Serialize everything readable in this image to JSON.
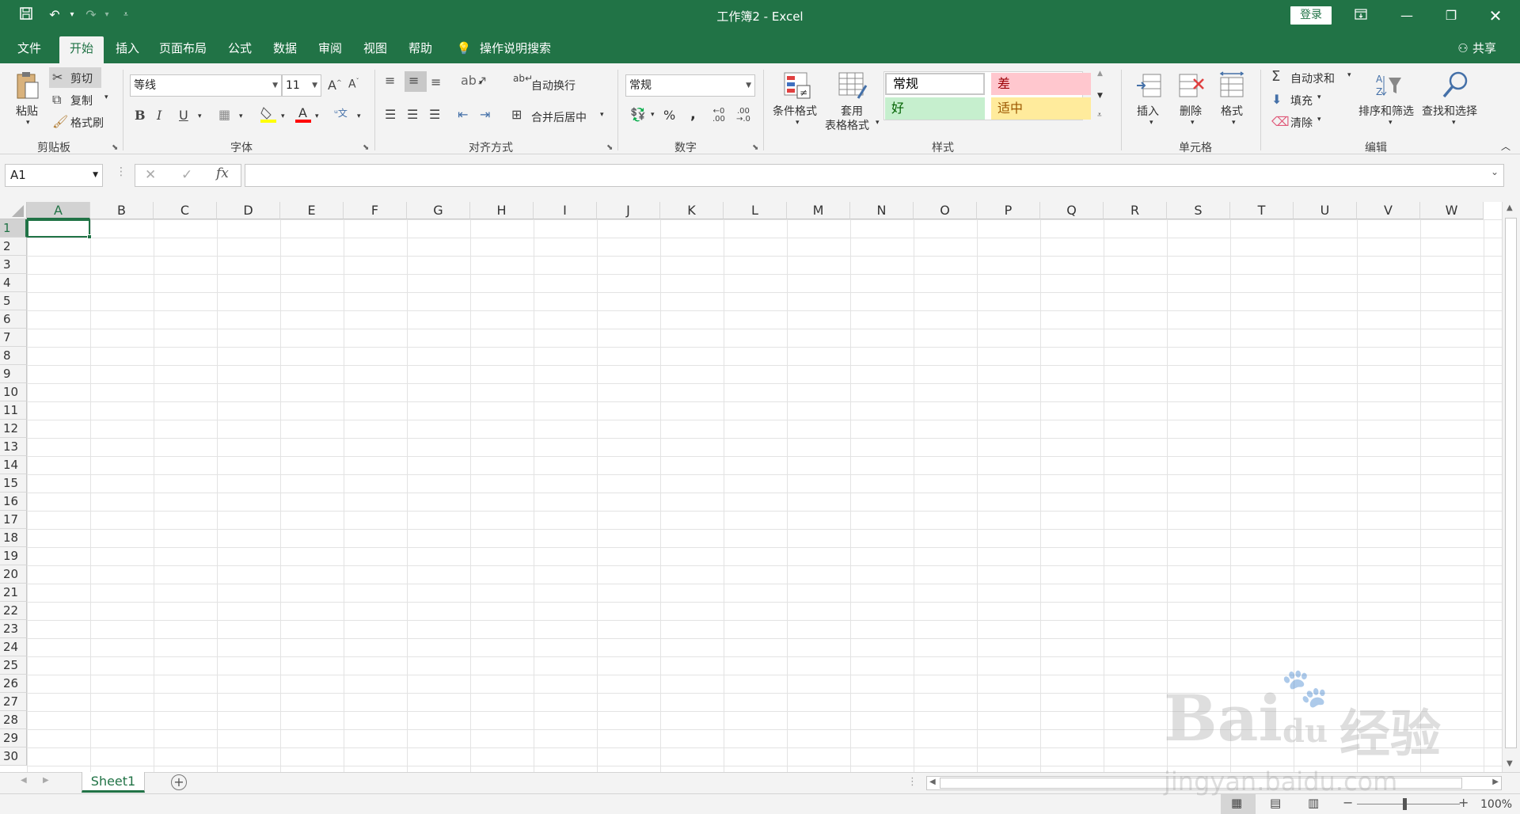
{
  "titlebar": {
    "title": "工作簿2  -  Excel",
    "login": "登录",
    "save_icon": "save-icon",
    "undo_icon": "undo-icon",
    "redo_icon": "redo-icon"
  },
  "tabs": [
    "文件",
    "开始",
    "插入",
    "页面布局",
    "公式",
    "数据",
    "审阅",
    "视图",
    "帮助"
  ],
  "tell_me": "操作说明搜索",
  "share": "共享",
  "clipboard": {
    "paste": "粘贴",
    "cut": "剪切",
    "copy": "复制",
    "format_painter": "格式刷",
    "label": "剪贴板"
  },
  "font": {
    "name": "等线",
    "size": "11",
    "label": "字体"
  },
  "alignment": {
    "wrap": "自动换行",
    "merge": "合并后居中",
    "label": "对齐方式"
  },
  "number": {
    "format": "常规",
    "percent": "%",
    "comma": ",",
    "label": "数字"
  },
  "styles": {
    "conditional": "条件格式",
    "table_line1": "套用",
    "table_line2": "表格格式",
    "normal": "常规",
    "bad": "差",
    "good": "好",
    "neutral": "适中",
    "label": "样式"
  },
  "cells": {
    "insert": "插入",
    "delete": "删除",
    "format": "格式",
    "label": "单元格"
  },
  "editing": {
    "autosum": "自动求和",
    "fill": "填充",
    "clear": "清除",
    "sort": "排序和筛选",
    "find": "查找和选择",
    "label": "编辑"
  },
  "formula_bar": {
    "name_box": "A1",
    "fx": "fx",
    "value": ""
  },
  "columns": [
    "A",
    "B",
    "C",
    "D",
    "E",
    "F",
    "G",
    "H",
    "I",
    "J",
    "K",
    "L",
    "M",
    "N",
    "O",
    "P",
    "Q",
    "R",
    "S",
    "T",
    "U",
    "V",
    "W"
  ],
  "rows": [
    "1",
    "2",
    "3",
    "4",
    "5",
    "6",
    "7",
    "8",
    "9",
    "10",
    "11",
    "12",
    "13",
    "14",
    "15",
    "16",
    "17",
    "18",
    "19",
    "20",
    "21",
    "22",
    "23",
    "24",
    "25",
    "26",
    "27",
    "28",
    "29",
    "30"
  ],
  "sheets": [
    "Sheet1"
  ],
  "status": {
    "zoom": "100%"
  },
  "watermark": {
    "brand": "Bai",
    "brand2": "du",
    "jy": "经验",
    "url": "jingyan.baidu.com"
  },
  "colors": {
    "accent": "#217346",
    "bad_bg": "#ffc7ce",
    "bad_fg": "#9c0006",
    "good_bg": "#c6efce",
    "good_fg": "#006100",
    "neutral_bg": "#ffeb9c",
    "neutral_fg": "#9c5700"
  }
}
